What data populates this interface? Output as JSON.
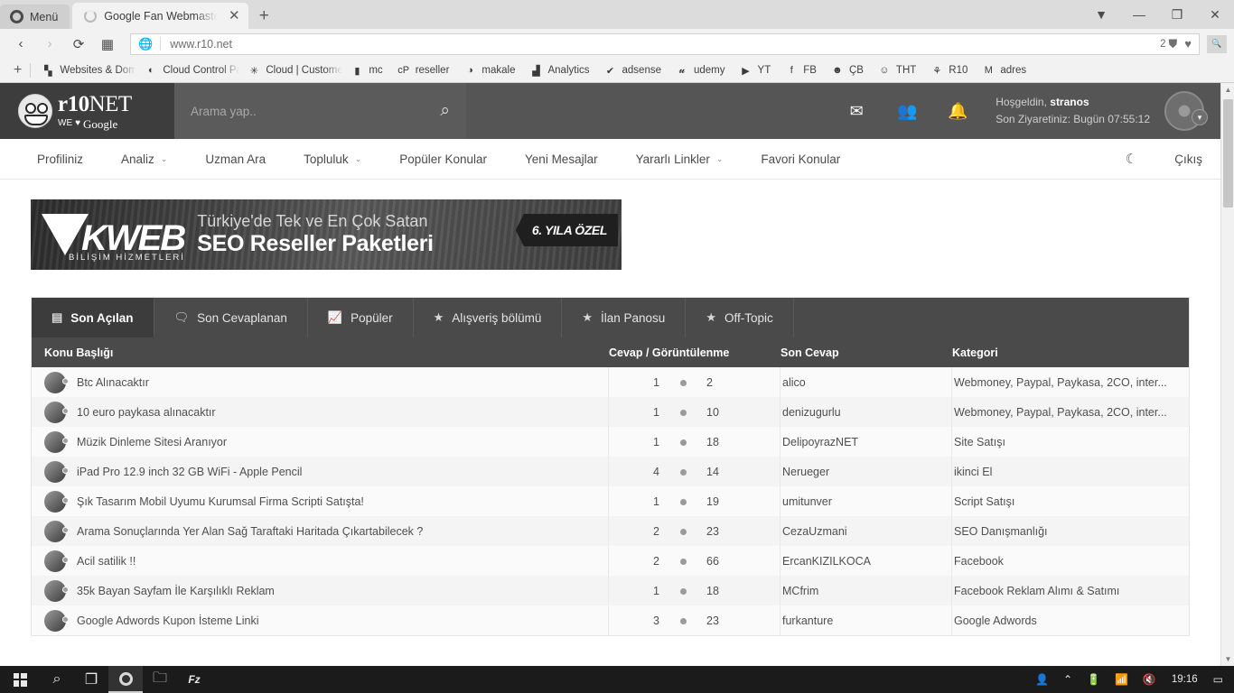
{
  "browser": {
    "menu_label": "Menü",
    "tab_title": "Google Fan Webmaster Fo",
    "tab_close": "✕",
    "newtab": "+",
    "back": "‹",
    "forward": "›",
    "reload": "⟳",
    "speeddial": "▦",
    "url": "www.r10.net",
    "blocked_count": "2",
    "window_controls": {
      "easy_setup": "▼",
      "minimize": "—",
      "maximize": "❐",
      "close": "✕"
    }
  },
  "bookmarks": {
    "add": "+",
    "items": [
      {
        "label": "Websites & Domains",
        "icon": "plesk-icon",
        "glyph": "▚",
        "clip": true
      },
      {
        "label": "Cloud Control Panel",
        "icon": "cloud-panel-icon",
        "glyph": "◐",
        "clip": true
      },
      {
        "label": "Cloud | Customer Ar",
        "icon": "asterisk-icon",
        "glyph": "✳",
        "clip": true
      },
      {
        "label": "mc",
        "icon": "document-icon",
        "glyph": "▮",
        "clip": false
      },
      {
        "label": "reseller",
        "icon": "cpanel-icon",
        "glyph": "cP",
        "clip": false
      },
      {
        "label": "makale",
        "icon": "circle-icon",
        "glyph": "◑",
        "clip": false
      },
      {
        "label": "Analytics",
        "icon": "analytics-icon",
        "glyph": "▟",
        "clip": false
      },
      {
        "label": "adsense",
        "icon": "adsense-icon",
        "glyph": "✔",
        "clip": false
      },
      {
        "label": "udemy",
        "icon": "udemy-icon",
        "glyph": "𝓾",
        "clip": false
      },
      {
        "label": "YT",
        "icon": "youtube-icon",
        "glyph": "▶",
        "clip": false
      },
      {
        "label": "FB",
        "icon": "facebook-icon",
        "glyph": "f",
        "clip": false
      },
      {
        "label": "ÇB",
        "icon": "avatar-icon",
        "glyph": "☻",
        "clip": false
      },
      {
        "label": "THT",
        "icon": "tht-icon",
        "glyph": "☺",
        "clip": false
      },
      {
        "label": "R10",
        "icon": "r10-icon",
        "glyph": "⚘",
        "clip": false
      },
      {
        "label": "adres",
        "icon": "maxthon-icon",
        "glyph": "M",
        "clip": false
      }
    ]
  },
  "site": {
    "logo": {
      "main": "r10",
      "net": "NET",
      "we": "WE",
      "heart": "♥",
      "google": "Google"
    },
    "search": {
      "placeholder": "Arama yap..",
      "value": "",
      "icon": "search-icon"
    },
    "header_icons": [
      {
        "name": "mail-icon",
        "glyph": "✉"
      },
      {
        "name": "friends-icon",
        "glyph": "👥"
      },
      {
        "name": "notifications-icon",
        "glyph": "🔔"
      }
    ],
    "welcome_line1_prefix": "Hoşgeldin, ",
    "welcome_username": "stranos",
    "welcome_line2": "Son Ziyaretiniz: Bugün 07:55:12",
    "avatar_chevron": "▾",
    "nav": [
      {
        "label": "Profiliniz",
        "caret": false
      },
      {
        "label": "Analiz",
        "caret": true
      },
      {
        "label": "Uzman Ara",
        "caret": false
      },
      {
        "label": "Topluluk",
        "caret": true
      },
      {
        "label": "Popüler Konular",
        "caret": false
      },
      {
        "label": "Yeni Mesajlar",
        "caret": false
      },
      {
        "label": "Yararlı Linkler",
        "caret": true
      },
      {
        "label": "Favori Konular",
        "caret": false
      }
    ],
    "caret_glyph": "⌄",
    "dark_mode_icon": "☾",
    "logout_label": "Çıkış"
  },
  "banner": {
    "brand": "KWEB",
    "brand_sub": "BİLİŞİM HİZMETLERİ",
    "line1": "Türkiye'de Tek ve En Çok Satan",
    "line2": "SEO Reseller Paketleri",
    "flag": "6. YILA ÖZEL"
  },
  "forum": {
    "tabs": [
      {
        "label": "Son Açılan",
        "icon": "list-icon",
        "glyph": "▤",
        "active": true
      },
      {
        "label": "Son Cevaplanan",
        "icon": "comment-icon",
        "glyph": "🗨",
        "active": false
      },
      {
        "label": "Popüler",
        "icon": "trending-icon",
        "glyph": "📈",
        "active": false
      },
      {
        "label": "Alışveriş bölümü",
        "icon": "star-icon",
        "glyph": "★",
        "active": false
      },
      {
        "label": "İlan Panosu",
        "icon": "star-icon",
        "glyph": "★",
        "active": false
      },
      {
        "label": "Off-Topic",
        "icon": "star-icon",
        "glyph": "★",
        "active": false
      }
    ],
    "columns": {
      "title": "Konu Başlığı",
      "replies_views": "Cevap / Görüntülenme",
      "last_reply": "Son Cevap",
      "category": "Kategori"
    },
    "rows": [
      {
        "title": "Btc Alınacaktır",
        "replies": "1",
        "views": "2",
        "last_reply": "alico",
        "category": "Webmoney, Paypal, Paykasa, 2CO, inter..."
      },
      {
        "title": "10 euro paykasa alınacaktır",
        "replies": "1",
        "views": "10",
        "last_reply": "denizugurlu",
        "category": "Webmoney, Paypal, Paykasa, 2CO, inter..."
      },
      {
        "title": "Müzik Dinleme Sitesi Aranıyor",
        "replies": "1",
        "views": "18",
        "last_reply": "DelipoyrazNET",
        "category": "Site Satışı"
      },
      {
        "title": "iPad Pro 12.9 inch 32 GB WiFi - Apple Pencil",
        "replies": "4",
        "views": "14",
        "last_reply": "Nerueger",
        "category": "ikinci El"
      },
      {
        "title": "Şık Tasarım Mobil Uyumu Kurumsal Firma Scripti Satışta!",
        "replies": "1",
        "views": "19",
        "last_reply": "umitunver",
        "category": "Script Satışı"
      },
      {
        "title": "Arama Sonuçlarında Yer Alan Sağ Taraftaki Haritada Çıkartabilecek ?",
        "replies": "2",
        "views": "23",
        "last_reply": "CezaUzmani",
        "category": "SEO Danışmanlığı"
      },
      {
        "title": "Acil satilik !!",
        "replies": "2",
        "views": "66",
        "last_reply": "ErcanKIZILKOCA",
        "category": "Facebook"
      },
      {
        "title": "35k Bayan Sayfam İle Karşılıklı Reklam",
        "replies": "1",
        "views": "18",
        "last_reply": "MCfrim",
        "category": "Facebook Reklam Alımı & Satımı"
      },
      {
        "title": "Google Adwords Kupon İsteme Linki",
        "replies": "3",
        "views": "23",
        "last_reply": "furkanture",
        "category": "Google Adwords"
      }
    ]
  },
  "taskbar": {
    "items": [
      {
        "name": "start-button",
        "glyph": ""
      },
      {
        "name": "search-icon",
        "glyph": "🔍"
      },
      {
        "name": "task-view-icon",
        "glyph": "❐"
      },
      {
        "name": "opera-taskbar-icon",
        "glyph": "O"
      },
      {
        "name": "file-explorer-icon",
        "glyph": "🗀"
      },
      {
        "name": "filezilla-icon",
        "glyph": "Fz"
      }
    ],
    "tray": {
      "people": "👤",
      "chevron": "⌃",
      "battery": "🔋",
      "wifi": "📶",
      "volume": "🔇",
      "clock": "19:16",
      "notifications": "▭"
    }
  },
  "colors": {
    "header_bg": "#555555",
    "logo_bg": "#3d3d3d",
    "tab_bar": "#4a4a4a",
    "active_tab": "#3c3c3c"
  }
}
